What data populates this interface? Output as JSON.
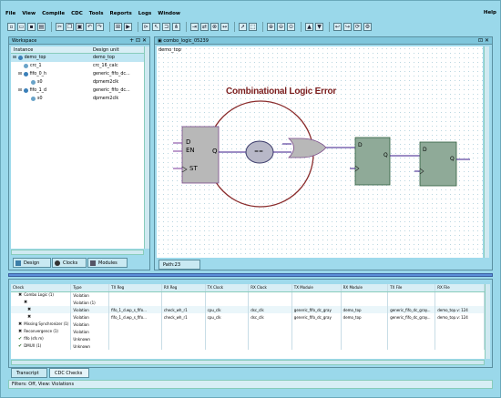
{
  "menu": [
    "File",
    "View",
    "Compile",
    "CDC",
    "Tools",
    "Reports",
    "Logs",
    "Window"
  ],
  "help": "Help",
  "toolbar_icons": [
    "new-icon",
    "open-icon",
    "save-icon",
    "print-icon",
    "cut-icon",
    "copy-icon",
    "paste-icon",
    "undo-icon",
    "redo-icon",
    "compile-icon",
    "run-icon",
    "schematic-icon",
    "pointer-icon",
    "zoom-icon",
    "fit-icon",
    "gate-icon",
    "up-icon",
    "down-icon",
    "settings-icon"
  ],
  "workspace": {
    "title": "Workspace",
    "col_instance": "Instance",
    "col_design_unit": "Design unit",
    "rows": [
      {
        "instance": "demo_top",
        "unit": "demo_top"
      },
      {
        "instance": "crc_1",
        "unit": "crc_16_calc"
      },
      {
        "instance": "fifo_0_h",
        "unit": "generic_fifo_dc..."
      },
      {
        "instance": "s0",
        "unit": "dpmem2clk"
      },
      {
        "instance": "fifo_1_d",
        "unit": "generic_fifo_dc..."
      },
      {
        "instance": "s0",
        "unit": "dpmem2clk"
      }
    ],
    "tabs": [
      "Design",
      "Clocks",
      "Modules"
    ]
  },
  "schematic": {
    "title": "combo_logic_05239",
    "breadcrumb": "demo_top",
    "annotation": "Combinational Logic Error",
    "pins": {
      "d": "D",
      "en": "EN",
      "q": "Q",
      "st": "ST",
      "eq": "==",
      "q2": "Q",
      "q3": "Q"
    },
    "tab": "Path:23"
  },
  "checks": {
    "headers": [
      "Check",
      "Type",
      "TX Reg",
      "RX Reg",
      "TX Clock",
      "RX Clock",
      "TX Module",
      "RX Module",
      "TX File",
      "RX File"
    ],
    "rows": [
      {
        "check": "Combo Logic (1)",
        "type": "Violation",
        "txreg": "",
        "rxreg": "",
        "txclk": "",
        "rxclk": "",
        "txmod": "",
        "rxmod": "",
        "txfile": "",
        "rxfile": ""
      },
      {
        "check": "",
        "type": "Violation (1)",
        "txreg": "",
        "rxreg": "",
        "txclk": "",
        "rxclk": "",
        "txmod": "",
        "rxmod": "",
        "txfile": "",
        "rxfile": ""
      },
      {
        "check": "",
        "type": "Violation",
        "txreg": "fifo_1_d.wp_s_fifo...",
        "rxreg": "check_wh_r1",
        "txclk": "cpu_clk",
        "rxclk": "dsc_clk",
        "txmod": "generic_fifo_dc_gray",
        "rxmod": "demo_top",
        "txfile": "generic_fifo_dc_gray...",
        "rxfile": "demo_top.v: 124"
      },
      {
        "check": "",
        "type": "Violation",
        "txreg": "fifo_1_d.wp_s_fifo...",
        "rxreg": "check_wh_r1",
        "txclk": "cpu_clk",
        "rxclk": "dsc_clk",
        "txmod": "generic_fifo_dc_gray",
        "rxmod": "demo_top",
        "txfile": "generic_fifo_dc_gray...",
        "rxfile": "demo_top.v: 124"
      },
      {
        "check": "Missing Synchronizer (1)",
        "type": "Violation",
        "txreg": "",
        "rxreg": "",
        "txclk": "",
        "rxclk": "",
        "txmod": "",
        "rxmod": "",
        "txfile": "",
        "rxfile": ""
      },
      {
        "check": "Reconvergence (1)",
        "type": "Violation",
        "txreg": "",
        "rxreg": "",
        "txclk": "",
        "rxclk": "",
        "txmod": "",
        "rxmod": "",
        "txfile": "",
        "rxfile": ""
      },
      {
        "check": "fifo (sfs m)",
        "type": "Unknown",
        "txreg": "",
        "rxreg": "",
        "txclk": "",
        "rxclk": "",
        "txmod": "",
        "rxmod": "",
        "txfile": "",
        "rxfile": ""
      },
      {
        "check": "DMUX (1)",
        "type": "Unknown",
        "txreg": "",
        "rxreg": "",
        "txclk": "",
        "rxclk": "",
        "txmod": "",
        "rxmod": "",
        "txfile": "",
        "rxfile": ""
      }
    ],
    "tabs": [
      "Transcript",
      "CDC Checks"
    ],
    "status": "Filters: Off,  View: Violations"
  },
  "colors": {
    "accent_circle": "#8a2c2c",
    "annotation": "#7a1d1d",
    "wire": "#3a1a8a",
    "flop": "#9a9a9a",
    "flop_green": "#5f8f6f"
  }
}
